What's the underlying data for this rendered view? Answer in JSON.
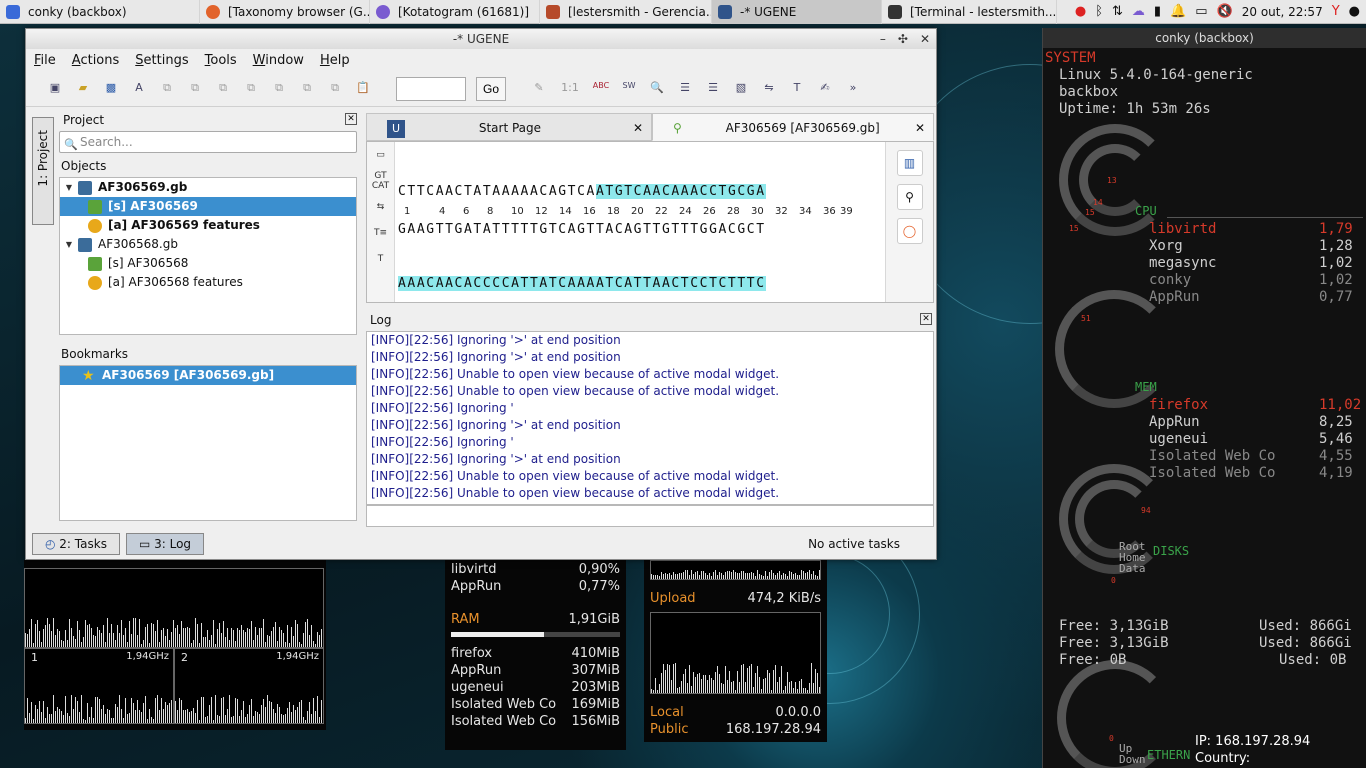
{
  "taskbar": {
    "items": [
      {
        "label": "conky (backbox)",
        "color": "#3a6ad8"
      },
      {
        "label": "[Taxonomy browser (G...",
        "color": "#e2632b"
      },
      {
        "label": "[Kotatogram (61681)]",
        "color": "#7a5bd0"
      },
      {
        "label": "[lestersmith - Gerencia...",
        "color": "#b64a2a"
      },
      {
        "label": "-* UGENE",
        "color": "#30548a"
      },
      {
        "label": "[Terminal - lestersmith...",
        "color": "#333333"
      }
    ],
    "clock": "20 out, 22:57"
  },
  "ugene": {
    "title": "-* UGENE",
    "menu": [
      "File",
      "Actions",
      "Settings",
      "Tools",
      "Window",
      "Help"
    ],
    "toolbar": {
      "zoom": "1:1",
      "go": "Go",
      "seq_buttons": [
        "ABC",
        "SW"
      ]
    },
    "left_tab": "1: Project",
    "project": {
      "title": "Project",
      "search_placeholder": "Search...",
      "objects_label": "Objects",
      "objects": [
        {
          "label": "AF306569.gb",
          "level": 0,
          "bold": true,
          "icon": "doc-icon"
        },
        {
          "label": "[s] AF306569",
          "level": 1,
          "bold": false,
          "selected": true,
          "icon": "sequence-icon"
        },
        {
          "label": "[a] AF306569 features",
          "level": 1,
          "bold": true,
          "icon": "annotation-icon"
        },
        {
          "label": "AF306568.gb",
          "level": 0,
          "bold": false,
          "icon": "doc-icon"
        },
        {
          "label": "[s] AF306568",
          "level": 1,
          "bold": false,
          "icon": "sequence-icon"
        },
        {
          "label": "[a] AF306568 features",
          "level": 1,
          "bold": false,
          "icon": "annotation-icon"
        }
      ],
      "bookmarks_label": "Bookmarks",
      "bookmark": "AF306569 [AF306569.gb]"
    },
    "tabs": {
      "start": "Start Page",
      "seq": "AF306569 [AF306569.gb]"
    },
    "sequence": {
      "top": "CTTCAACTATAAAAACAGTCAATGTCAACAAACCTGCGA",
      "top_plain": "CTTCAACTATAAAAACAGTCA",
      "top_hl": "ATGTCAACAAACCTGCGA",
      "ruler": [
        "1",
        "4",
        "6",
        "8",
        "10",
        "12",
        "14",
        "16",
        "18",
        "20",
        "22",
        "24",
        "26",
        "28",
        "30",
        "32",
        "34",
        "36",
        "39"
      ],
      "complement": "GAAGTTGATATTTTTGTCAGTTACAGTTGTTTGGACGCT",
      "translation": "AAACAACACCCCATTATCAAAATCATTAACTCCTCTTTC"
    },
    "log": {
      "title": "Log",
      "lines": [
        "[INFO][22:56] Ignoring '>' at end position",
        "[INFO][22:56] Ignoring '>' at end position",
        "[INFO][22:56] Unable to open view because of active modal widget.",
        "[INFO][22:56] Unable to open view because of active modal widget.",
        "[INFO][22:56] Ignoring '",
        "[INFO][22:56] Ignoring '>' at end position",
        "[INFO][22:56] Ignoring '",
        "[INFO][22:56] Ignoring '>' at end position",
        "[INFO][22:56] Unable to open view because of active modal widget.",
        "[INFO][22:56] Unable to open view because of active modal widget."
      ]
    },
    "bottom": {
      "tasks": "2: Tasks",
      "log": "3: Log",
      "status": "No active tasks"
    }
  },
  "conky_right": {
    "title": "conky (backbox)",
    "system": "SYSTEM",
    "kernel": "Linux 5.4.0-164-generic",
    "host": "backbox",
    "uptime": "Uptime: 1h 53m 26s",
    "ring_cpu": [
      "13",
      "14",
      "15",
      "15"
    ],
    "cpu_label": "CPU",
    "cpu_procs": [
      {
        "name": "libvirtd",
        "val": "1,79"
      },
      {
        "name": "Xorg",
        "val": "1,28"
      },
      {
        "name": "megasync",
        "val": "1,02"
      },
      {
        "name": "conky",
        "val": "1,02"
      },
      {
        "name": "AppRun",
        "val": "0,77"
      }
    ],
    "ring_mem": "51",
    "mem_label": "MEM",
    "mem_procs": [
      {
        "name": "firefox",
        "val": "11,02"
      },
      {
        "name": "AppRun",
        "val": "8,25"
      },
      {
        "name": "ugeneui",
        "val": "5,46"
      },
      {
        "name": "Isolated Web Co",
        "val": "4,55"
      },
      {
        "name": "Isolated Web Co",
        "val": "4,19"
      }
    ],
    "ring_disk": "94",
    "disk_labels": [
      "Root",
      "Home",
      "Data"
    ],
    "disks_label": "DISKS",
    "disk_zero": "0",
    "disks": [
      {
        "free": "Free: 3,13GiB",
        "used": "Used: 866Gi"
      },
      {
        "free": "Free: 3,13GiB",
        "used": "Used: 866Gi"
      },
      {
        "free": "Free: 0B",
        "used": "Used: 0B"
      }
    ],
    "net_zero": "0",
    "net_up": "Up",
    "net_down": "Down",
    "ethernet": "ETHERN",
    "ip": "IP: 168.197.28.94",
    "country": "Country:"
  },
  "conky_bottom": {
    "cpu_graph_1": {
      "core": "1",
      "freq": "1,94GHz"
    },
    "cpu_graph_2": {
      "core": "2",
      "freq": "1,94GHz"
    },
    "proc_top": [
      {
        "name": "libvirtd",
        "val": "0,90%"
      },
      {
        "name": "AppRun",
        "val": "0,77%"
      }
    ],
    "ram_label": "RAM",
    "ram_val": "1,91GiB",
    "ram_fraction": 0.55,
    "ram_procs": [
      {
        "name": "firefox",
        "val": "410MiB"
      },
      {
        "name": "AppRun",
        "val": "307MiB"
      },
      {
        "name": "ugeneui",
        "val": "203MiB"
      },
      {
        "name": "Isolated Web Co",
        "val": "169MiB"
      },
      {
        "name": "Isolated Web Co",
        "val": "156MiB"
      }
    ],
    "upload_label": "Upload",
    "upload_val": "474,2 KiB/s",
    "local_label": "Local",
    "local_val": "0.0.0.0",
    "public_label": "Public",
    "public_val": "168.197.28.94"
  }
}
